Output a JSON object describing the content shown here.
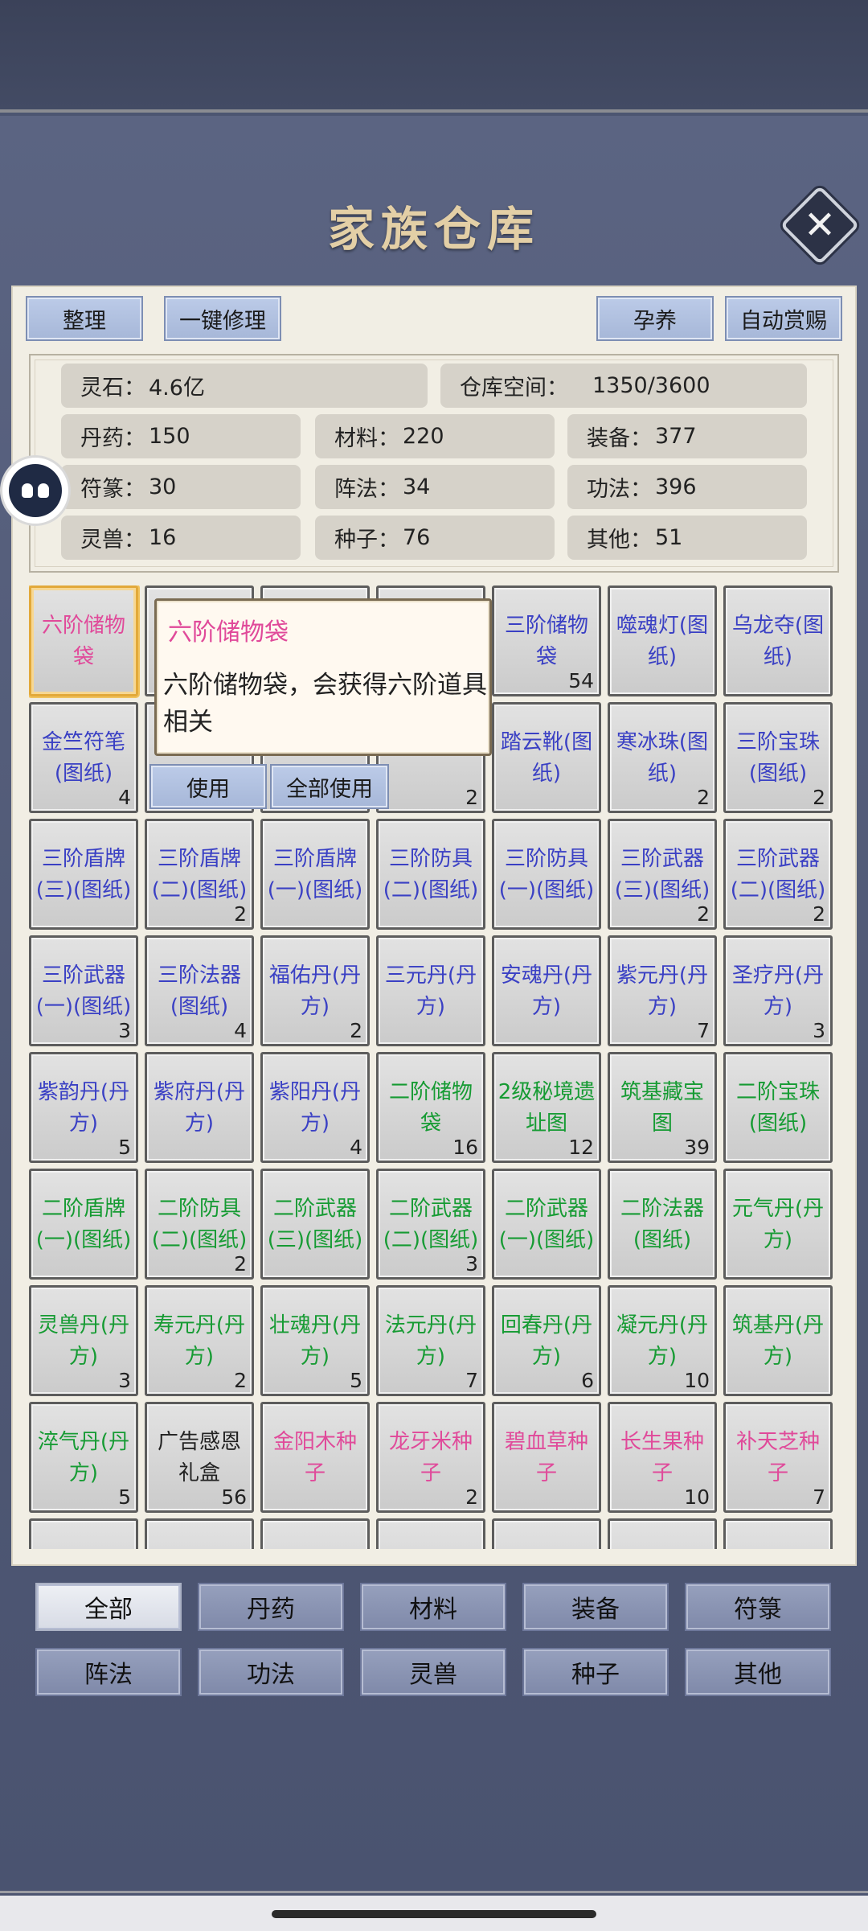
{
  "title": "家族仓库",
  "toolbar": {
    "sort": "整理",
    "repair_all": "一键修理",
    "nurture": "孕养",
    "auto_reward": "自动赏赐"
  },
  "stats": {
    "lingshi": {
      "label": "灵石：",
      "value": "4.6亿"
    },
    "space": {
      "label": "仓库空间：",
      "value": "1350/3600"
    },
    "danyao": {
      "label": "丹药：",
      "value": "150"
    },
    "cailiao": {
      "label": "材料：",
      "value": "220"
    },
    "zhuangbei": {
      "label": "装备：",
      "value": "377"
    },
    "fulu": {
      "label": "符篆：",
      "value": "30"
    },
    "zhenfa": {
      "label": "阵法：",
      "value": "34"
    },
    "gongfa": {
      "label": "功法：",
      "value": "396"
    },
    "lingshou": {
      "label": "灵兽：",
      "value": "16"
    },
    "zhongzi": {
      "label": "种子：",
      "value": "76"
    },
    "qita": {
      "label": "其他：",
      "value": "51"
    }
  },
  "tooltip": {
    "title": "六阶储物袋",
    "desc": "六阶储物袋，会获得六阶道具相关"
  },
  "actions": {
    "use": "使用",
    "use_all": "全部使用"
  },
  "items": [
    {
      "name": "六阶储物袋",
      "count": "",
      "color": "#e04a9a"
    },
    {
      "name": "",
      "count": "",
      "color": "#3a40c4"
    },
    {
      "name": "",
      "count": "",
      "color": "#3a40c4"
    },
    {
      "name": "",
      "count": "",
      "color": "#3a40c4"
    },
    {
      "name": "三阶储物袋",
      "count": "54",
      "color": "#3a40c4"
    },
    {
      "name": "噬魂灯(图纸)",
      "count": "",
      "color": "#3a40c4"
    },
    {
      "name": "乌龙夺(图纸)",
      "count": "",
      "color": "#3a40c4"
    },
    {
      "name": "金竺符笔(图纸)",
      "count": "4",
      "color": "#3a40c4"
    },
    {
      "name": "",
      "count": "",
      "color": "#3a40c4"
    },
    {
      "name": "",
      "count": "",
      "color": "#3a40c4"
    },
    {
      "name": "纸)",
      "count": "2",
      "color": "#3a40c4"
    },
    {
      "name": "踏云靴(图纸)",
      "count": "",
      "color": "#3a40c4"
    },
    {
      "name": "寒冰珠(图纸)",
      "count": "2",
      "color": "#3a40c4"
    },
    {
      "name": "三阶宝珠(图纸)",
      "count": "2",
      "color": "#3a40c4"
    },
    {
      "name": "三阶盾牌(三)(图纸)",
      "count": "",
      "color": "#3a40c4"
    },
    {
      "name": "三阶盾牌(二)(图纸)",
      "count": "2",
      "color": "#3a40c4"
    },
    {
      "name": "三阶盾牌(一)(图纸)",
      "count": "",
      "color": "#3a40c4"
    },
    {
      "name": "三阶防具(二)(图纸)",
      "count": "",
      "color": "#3a40c4"
    },
    {
      "name": "三阶防具(一)(图纸)",
      "count": "",
      "color": "#3a40c4"
    },
    {
      "name": "三阶武器(三)(图纸)",
      "count": "2",
      "color": "#3a40c4"
    },
    {
      "name": "三阶武器(二)(图纸)",
      "count": "2",
      "color": "#3a40c4"
    },
    {
      "name": "三阶武器(一)(图纸)",
      "count": "3",
      "color": "#3a40c4"
    },
    {
      "name": "三阶法器(图纸)",
      "count": "4",
      "color": "#3a40c4"
    },
    {
      "name": "福佑丹(丹方)",
      "count": "2",
      "color": "#3a40c4"
    },
    {
      "name": "三元丹(丹方)",
      "count": "",
      "color": "#3a40c4"
    },
    {
      "name": "安魂丹(丹方)",
      "count": "",
      "color": "#3a40c4"
    },
    {
      "name": "紫元丹(丹方)",
      "count": "7",
      "color": "#3a40c4"
    },
    {
      "name": "圣疗丹(丹方)",
      "count": "3",
      "color": "#3a40c4"
    },
    {
      "name": "紫韵丹(丹方)",
      "count": "5",
      "color": "#3a40c4"
    },
    {
      "name": "紫府丹(丹方)",
      "count": "",
      "color": "#3a40c4"
    },
    {
      "name": "紫阳丹(丹方)",
      "count": "4",
      "color": "#3a40c4"
    },
    {
      "name": "二阶储物袋",
      "count": "16",
      "color": "#169b33"
    },
    {
      "name": "2级秘境遗址图",
      "count": "12",
      "color": "#169b33"
    },
    {
      "name": "筑基藏宝图",
      "count": "39",
      "color": "#169b33"
    },
    {
      "name": "二阶宝珠(图纸)",
      "count": "",
      "color": "#169b33"
    },
    {
      "name": "二阶盾牌(一)(图纸)",
      "count": "",
      "color": "#169b33"
    },
    {
      "name": "二阶防具(二)(图纸)",
      "count": "2",
      "color": "#169b33"
    },
    {
      "name": "二阶武器(三)(图纸)",
      "count": "",
      "color": "#169b33"
    },
    {
      "name": "二阶武器(二)(图纸)",
      "count": "3",
      "color": "#169b33"
    },
    {
      "name": "二阶武器(一)(图纸)",
      "count": "",
      "color": "#169b33"
    },
    {
      "name": "二阶法器(图纸)",
      "count": "",
      "color": "#169b33"
    },
    {
      "name": "元气丹(丹方)",
      "count": "",
      "color": "#169b33"
    },
    {
      "name": "灵兽丹(丹方)",
      "count": "3",
      "color": "#169b33"
    },
    {
      "name": "寿元丹(丹方)",
      "count": "2",
      "color": "#169b33"
    },
    {
      "name": "壮魂丹(丹方)",
      "count": "5",
      "color": "#169b33"
    },
    {
      "name": "法元丹(丹方)",
      "count": "7",
      "color": "#169b33"
    },
    {
      "name": "回春丹(丹方)",
      "count": "6",
      "color": "#169b33"
    },
    {
      "name": "凝元丹(丹方)",
      "count": "10",
      "color": "#169b33"
    },
    {
      "name": "筑基丹(丹方)",
      "count": "",
      "color": "#169b33"
    },
    {
      "name": "淬气丹(丹方)",
      "count": "5",
      "color": "#169b33"
    },
    {
      "name": "广告感恩礼盒",
      "count": "56",
      "color": "#222222"
    },
    {
      "name": "金阳木种子",
      "count": "",
      "color": "#e04a9a"
    },
    {
      "name": "龙牙米种子",
      "count": "2",
      "color": "#e04a9a"
    },
    {
      "name": "碧血草种子",
      "count": "",
      "color": "#e04a9a"
    },
    {
      "name": "长生果种子",
      "count": "10",
      "color": "#e04a9a"
    },
    {
      "name": "补天芝种子",
      "count": "7",
      "color": "#e04a9a"
    }
  ],
  "categories": [
    "全部",
    "丹药",
    "材料",
    "装备",
    "符箓",
    "阵法",
    "功法",
    "灵兽",
    "种子",
    "其他"
  ],
  "colors": {
    "accent_pink": "#e04a9a",
    "blue_item": "#3a40c4",
    "green_item": "#169b33",
    "panel_bg": "#f1eee4"
  }
}
